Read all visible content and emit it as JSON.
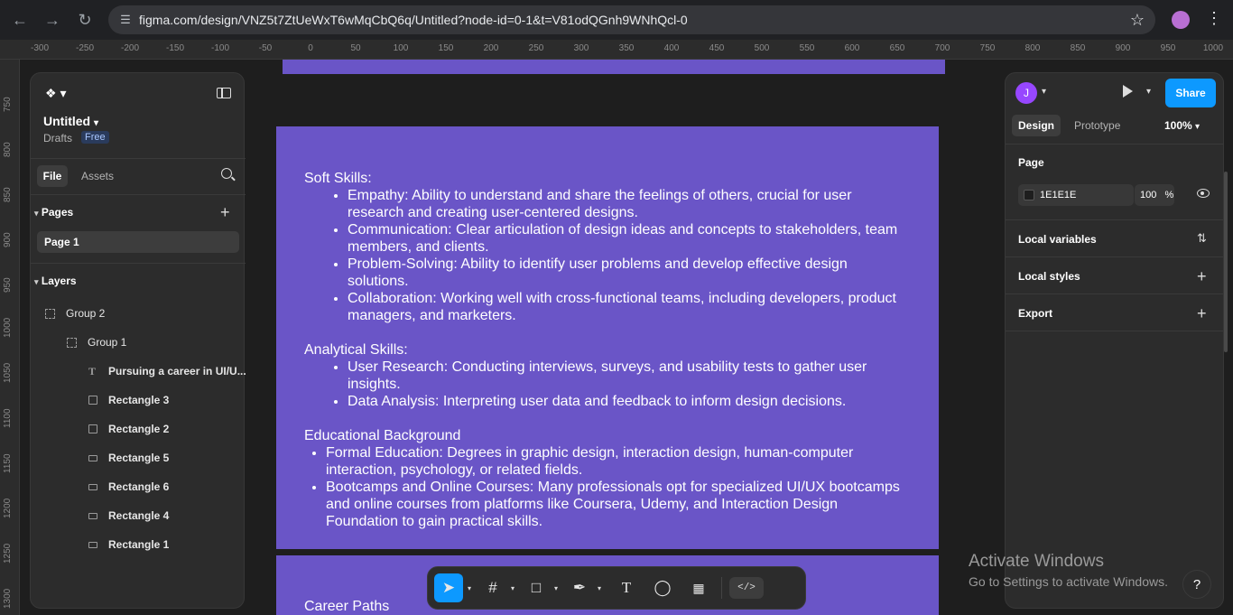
{
  "browser": {
    "url": "figma.com/design/VNZ5t7ZtUeWxT6wMqCbQ6q/Untitled?node-id=0-1&t=V81odQGnh9WNhQcl-0",
    "icons": [
      "back-icon",
      "forward-icon",
      "reload-icon",
      "site-settings-icon",
      "bookmark-star-icon",
      "profile-avatar",
      "kebab-menu-icon"
    ]
  },
  "ruler": {
    "top": [
      "-300",
      "-250",
      "-200",
      "-150",
      "-100",
      "-50",
      "0",
      "50",
      "100",
      "150",
      "200",
      "250",
      "300",
      "350",
      "400",
      "450",
      "500",
      "550",
      "600",
      "650",
      "700",
      "750",
      "800",
      "850",
      "900",
      "950",
      "1000"
    ],
    "left": [
      "750",
      "800",
      "850",
      "900",
      "950",
      "1000",
      "1050",
      "1100",
      "1150",
      "1200",
      "1250",
      "1300"
    ]
  },
  "left_panel": {
    "file_title": "Untitled",
    "drafts_label": "Drafts",
    "plan_badge": "Free",
    "tabs": {
      "file": "File",
      "assets": "Assets"
    },
    "pages_heading": "Pages",
    "pages": [
      "Page 1"
    ],
    "layers_heading": "Layers",
    "layers": [
      {
        "name": "Group 2",
        "type": "group",
        "level": 0
      },
      {
        "name": "Group 1",
        "type": "group",
        "level": 1
      },
      {
        "name": "Pursuing a career in UI/U...",
        "type": "text",
        "level": 2
      },
      {
        "name": "Rectangle 3",
        "type": "rect",
        "level": 2
      },
      {
        "name": "Rectangle 2",
        "type": "rect",
        "level": 2
      },
      {
        "name": "Rectangle 5",
        "type": "rect-flat",
        "level": 2
      },
      {
        "name": "Rectangle 6",
        "type": "rect-flat",
        "level": 2
      },
      {
        "name": "Rectangle 4",
        "type": "rect-flat",
        "level": 2
      },
      {
        "name": "Rectangle 1",
        "type": "rect-flat",
        "level": 2
      }
    ]
  },
  "canvas": {
    "frame_color": "#6a55c7",
    "soft_skills_heading": "Soft Skills:",
    "soft_skills": [
      "Empathy: Ability to understand and share the feelings of others, crucial for user research and creating user-centered designs.",
      "Communication: Clear articulation of design ideas and concepts to stakeholders, team members, and clients.",
      "Problem-Solving: Ability to identify user problems and develop effective design solutions.",
      "Collaboration: Working well with cross-functional teams, including developers, product managers, and marketers."
    ],
    "analytical_heading": "Analytical Skills:",
    "analytical_skills": [
      "User Research: Conducting interviews, surveys, and usability tests to gather user insights.",
      "Data Analysis: Interpreting user data and feedback to inform design decisions."
    ],
    "education_heading": "Educational Background",
    "education": [
      "Formal Education: Degrees in graphic design, interaction design, human-computer interaction, psychology, or related fields.",
      "Bootcamps and Online Courses: Many professionals opt for specialized UI/UX bootcamps and online courses from platforms like Coursera, Udemy, and Interaction Design Foundation to gain practical skills."
    ],
    "next_card_heading": "Career Paths"
  },
  "right_panel": {
    "avatar_letter": "J",
    "share_label": "Share",
    "tabs": {
      "design": "Design",
      "prototype": "Prototype"
    },
    "zoom": "100%",
    "page_heading": "Page",
    "page_color": "1E1E1E",
    "page_opacity": "100",
    "opacity_unit": "%",
    "local_variables": "Local variables",
    "local_styles": "Local styles",
    "export": "Export",
    "accent": "#0d99ff"
  },
  "toolbar": {
    "tools": [
      "move-tool",
      "frame-tool",
      "shape-tool",
      "pen-tool",
      "text-tool",
      "comment-tool",
      "actions-tool",
      "dev-mode-toggle"
    ]
  },
  "watermark": {
    "title": "Activate Windows",
    "subtitle": "Go to Settings to activate Windows."
  },
  "help_label": "?"
}
